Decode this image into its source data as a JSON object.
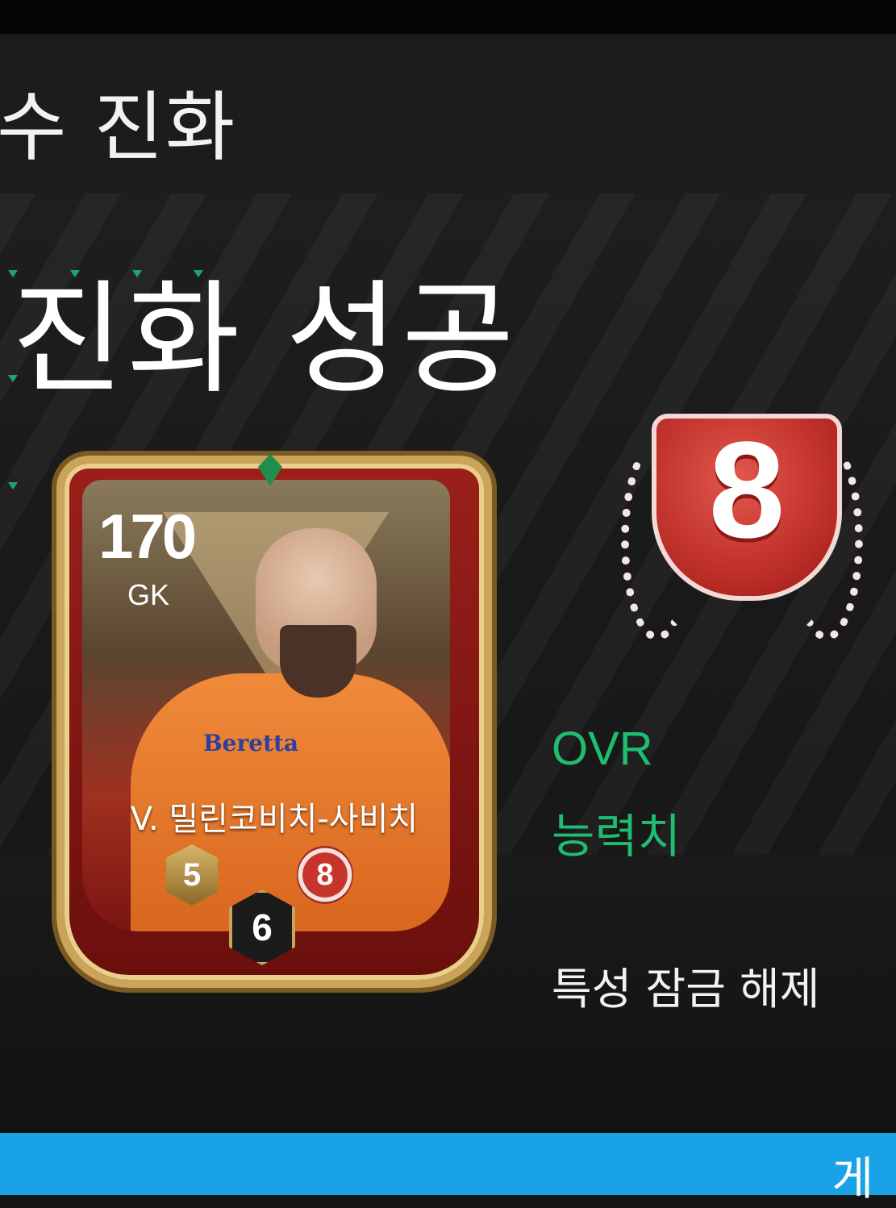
{
  "header": {
    "title": "수 진화"
  },
  "result": {
    "title": "진화 성공"
  },
  "card": {
    "ovr": "170",
    "position": "GK",
    "name": "V. 밀린코비치-사비치",
    "sponsor": "Beretta",
    "badge_left": "5",
    "badge_right": "8",
    "badge_level": "6"
  },
  "grade": {
    "value": "8"
  },
  "stats": {
    "ovr_label": "OVR",
    "ability_label": "능력치",
    "trait_label": "특성 잠금 해제"
  },
  "footer": {
    "confirm_label": "게"
  },
  "colors": {
    "accent_green": "#1fbd6f",
    "confirm_blue": "#1aa2e8",
    "grade_red": "#c7342c",
    "card_gold": "#c9a45a"
  }
}
